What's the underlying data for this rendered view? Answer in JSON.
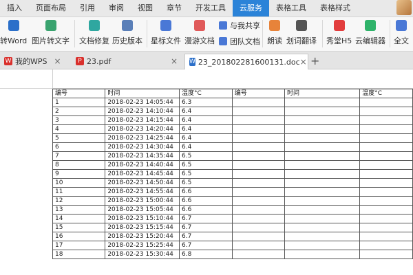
{
  "menu": {
    "items": [
      "插入",
      "页面布局",
      "引用",
      "审阅",
      "视图",
      "章节",
      "开发工具",
      "云服务",
      "表格工具",
      "表格样式"
    ],
    "active_index": 7
  },
  "ribbon": {
    "buttons": [
      {
        "label": "转Word",
        "icon": "to-word-icon",
        "color": "#2b6fc9"
      },
      {
        "label": "图片转文字",
        "icon": "image-to-text-icon",
        "color": "#3aa36f"
      },
      {
        "label": "文档修复",
        "icon": "doc-repair-icon",
        "color": "#2fa7a0"
      },
      {
        "label": "历史版本",
        "icon": "history-icon",
        "color": "#5a7fb8"
      },
      {
        "label": "星标文件",
        "icon": "star-file-icon",
        "color": "#4a78d6"
      },
      {
        "label": "漫游文档",
        "icon": "roaming-doc-icon",
        "color": "#e05a5a"
      },
      {
        "label": "朗读",
        "icon": "read-aloud-icon",
        "color": "#e7833a"
      },
      {
        "label": "划词翻译",
        "icon": "translate-icon",
        "color": "#555555"
      },
      {
        "label": "秀堂H5",
        "icon": "h5-icon",
        "color": "#e23d3d"
      },
      {
        "label": "云编辑器",
        "icon": "cloud-editor-icon",
        "color": "#2fb36a"
      },
      {
        "label": "全文"
      }
    ],
    "small_buttons": [
      {
        "label": "与我共享",
        "icon": "share-icon",
        "color": "#4a78d6"
      },
      {
        "label": "团队文档",
        "icon": "team-doc-icon",
        "color": "#4a78d6"
      }
    ]
  },
  "tabs": [
    {
      "label": "我的WPS",
      "icon": "wps-icon",
      "color": "#d9302c"
    },
    {
      "label": "23.pdf",
      "icon": "pdf-icon",
      "color": "#d9302c"
    },
    {
      "label": "23_201802281600131.doc",
      "icon": "doc-icon",
      "color": "#2b6fc9"
    }
  ],
  "close_glyph": "×",
  "new_tab_glyph": "+",
  "table": {
    "headers": [
      "编号",
      "时间",
      "温度°C",
      "编号",
      "时间",
      "温度°C"
    ],
    "rows": [
      [
        "1",
        "2018-02-23 14:05:44",
        "6.3"
      ],
      [
        "2",
        "2018-02-23 14:10:44",
        "6.4"
      ],
      [
        "3",
        "2018-02-23 14:15:44",
        "6.4"
      ],
      [
        "4",
        "2018-02-23 14:20:44",
        "6.4"
      ],
      [
        "5",
        "2018-02-23 14:25:44",
        "6.4"
      ],
      [
        "6",
        "2018-02-23 14:30:44",
        "6.4"
      ],
      [
        "7",
        "2018-02-23 14:35:44",
        "6.5"
      ],
      [
        "8",
        "2018-02-23 14:40:44",
        "6.5"
      ],
      [
        "9",
        "2018-02-23 14:45:44",
        "6.5"
      ],
      [
        "10",
        "2018-02-23 14:50:44",
        "6.5"
      ],
      [
        "11",
        "2018-02-23 14:55:44",
        "6.6"
      ],
      [
        "12",
        "2018-02-23 15:00:44",
        "6.6"
      ],
      [
        "13",
        "2018-02-23 15:05:44",
        "6.6"
      ],
      [
        "14",
        "2018-02-23 15:10:44",
        "6.7"
      ],
      [
        "15",
        "2018-02-23 15:15:44",
        "6.7"
      ],
      [
        "16",
        "2018-02-23 15:20:44",
        "6.7"
      ],
      [
        "17",
        "2018-02-23 15:25:44",
        "6.7"
      ],
      [
        "18",
        "2018-02-23 15:30:44",
        "6.8"
      ]
    ]
  }
}
